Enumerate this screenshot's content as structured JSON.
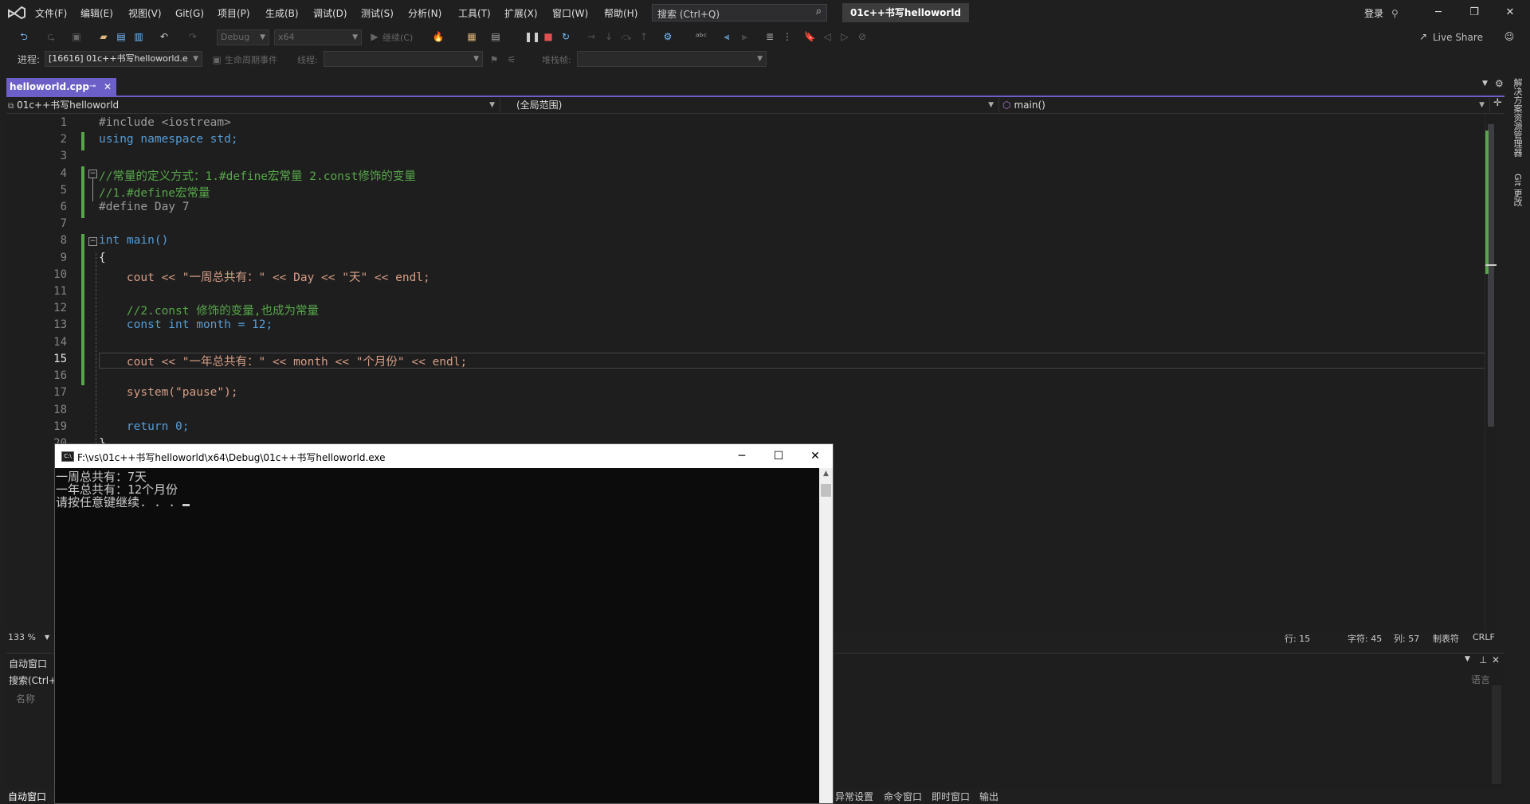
{
  "menu": {
    "items": [
      "文件(F)",
      "编辑(E)",
      "视图(V)",
      "Git(G)",
      "项目(P)",
      "生成(B)",
      "调试(D)",
      "测试(S)",
      "分析(N)",
      "工具(T)",
      "扩展(X)",
      "窗口(W)",
      "帮助(H)"
    ],
    "search_placeholder": "搜索 (Ctrl+Q)",
    "solution_title": "01c++书写helloworld",
    "login": "登录"
  },
  "toolbar": {
    "config": "Debug",
    "platform": "x64",
    "continue_label": "继续(C)",
    "live_share": "Live Share"
  },
  "debug_bar": {
    "process_label": "进程:",
    "process_value": "[16616] 01c++书写helloworld.e",
    "lifecycle_label": "生命周期事件",
    "thread_label": "线程:",
    "stack_label": "堆栈帧:"
  },
  "editor": {
    "tab_title": "helloworld.cpp",
    "nav_project": "01c++书写helloworld",
    "nav_scope": "(全局范围)",
    "nav_member": "main()",
    "line_numbers": [
      "1",
      "2",
      "3",
      "4",
      "5",
      "6",
      "7",
      "8",
      "9",
      "10",
      "11",
      "12",
      "13",
      "14",
      "15",
      "16",
      "17",
      "18",
      "19",
      "20"
    ],
    "lines": [
      "#include <iostream>",
      "using namespace std;",
      "",
      "//常量的定义方式：1.#define宏常量 2.const修饰的变量",
      "//1.#define宏常量",
      "#define Day 7",
      "",
      "int main()",
      "{",
      "    cout << \"一周总共有：\" << Day << \"天\" << endl;",
      "",
      "    //2.const 修饰的变量,也成为常量",
      "    const int month = 12;",
      "",
      "    cout << \"一年总共有：\" << month << \"个月份\" << endl;",
      "",
      "    system(\"pause\");",
      "",
      "    return 0;",
      "}"
    ],
    "current_line": 15
  },
  "status": {
    "zoom": "133 %",
    "row": "行: 15",
    "char": "字符: 45",
    "col": "列: 57",
    "tabs": "制表符",
    "eol": "CRLF"
  },
  "bottom_panel": {
    "title": "自动窗口",
    "search": "搜索(Ctrl+",
    "col_name": "名称",
    "col_lang": "语言"
  },
  "bottom_tabs": [
    "自动窗口",
    "异常设置",
    "命令窗口",
    "即时窗口",
    "输出"
  ],
  "side_tabs": [
    "解决方案资源管理器",
    "Git 更改"
  ],
  "console": {
    "title": "F:\\vs\\01c++书写helloworld\\x64\\Debug\\01c++书写helloworld.exe",
    "lines": [
      "一周总共有：7天",
      "一年总共有：12个月份",
      "请按任意键继续. . . "
    ]
  }
}
